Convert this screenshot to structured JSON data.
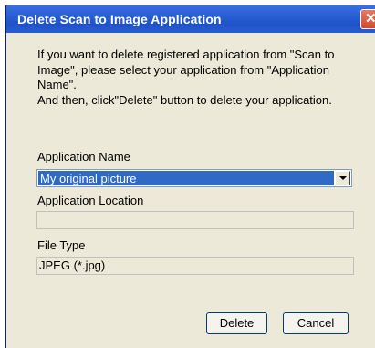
{
  "dialog": {
    "title": "Delete Scan to Image Application",
    "instructions": [
      "If you want to delete registered application from \"Scan to",
      "Image\", please select your application from \"Application",
      "Name\".",
      "And then, click\"Delete\" button to delete your application."
    ],
    "application_name": {
      "label": "Application Name",
      "selected": "My original picture"
    },
    "application_location": {
      "label": "Application Location",
      "value": ""
    },
    "file_type": {
      "label": "File Type",
      "value": "JPEG (*.jpg)"
    },
    "buttons": {
      "delete": "Delete",
      "cancel": "Cancel"
    }
  },
  "colors": {
    "titlebar": "#2a5fd6",
    "selection": "#316ac5",
    "window_background": "#ece9d8",
    "close_button": "#d5482b"
  },
  "icons": {
    "close": "close-icon",
    "dropdown": "chevron-down-icon"
  }
}
